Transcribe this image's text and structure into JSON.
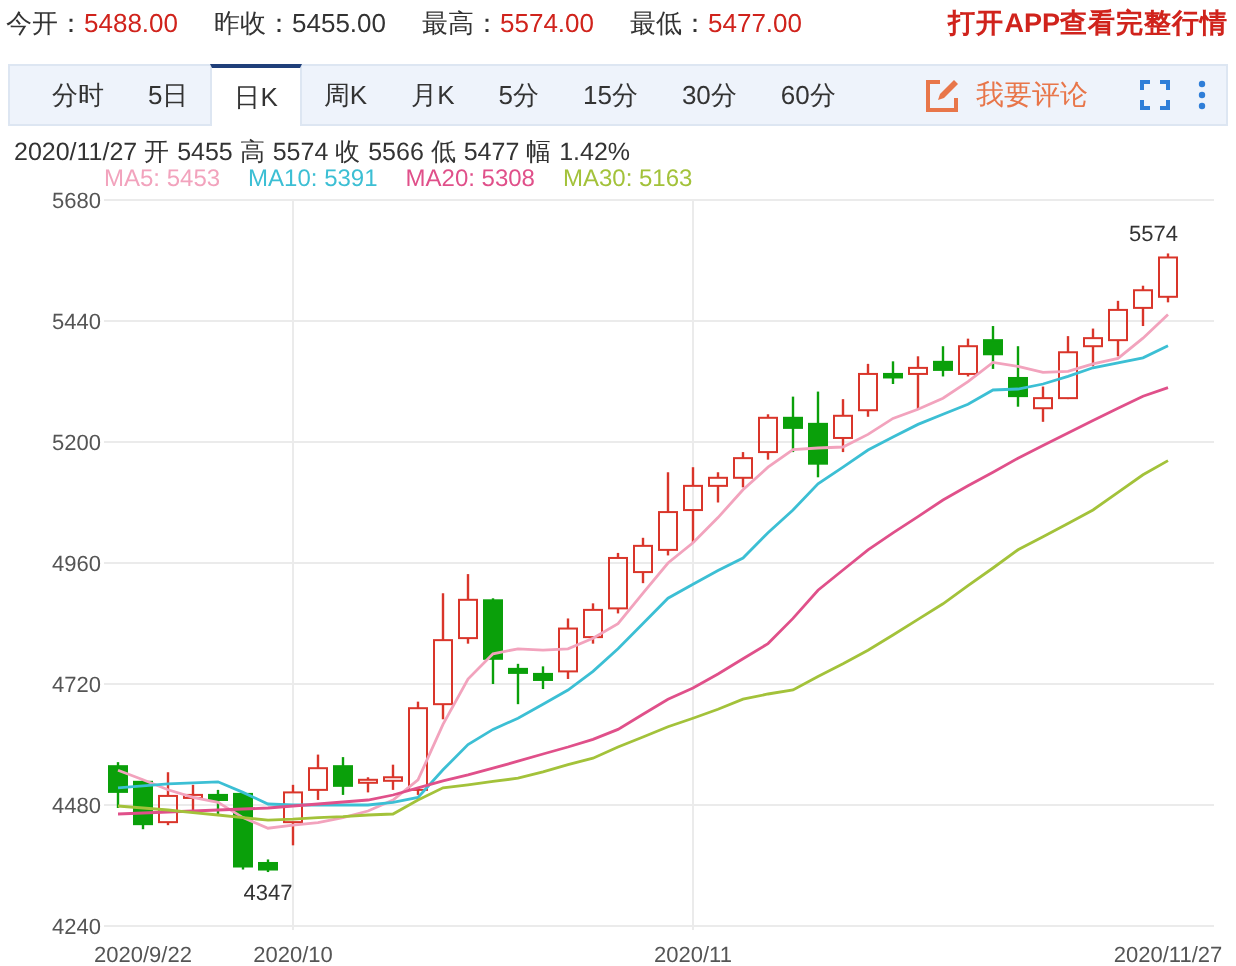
{
  "quote_stats": [
    {
      "label": "今开：",
      "value": "5488.00",
      "kind": "up"
    },
    {
      "label": "昨收：",
      "value": "5455.00",
      "kind": "flat"
    },
    {
      "label": "最高：",
      "value": "5574.00",
      "kind": "up"
    },
    {
      "label": "最低：",
      "value": "5477.00",
      "kind": "up"
    }
  ],
  "app_link": "打开APP查看完整行情",
  "tabs": [
    {
      "label": "分时",
      "selected": false
    },
    {
      "label": "5日",
      "selected": false
    },
    {
      "label": "日K",
      "selected": true
    },
    {
      "label": "周K",
      "selected": false
    },
    {
      "label": "月K",
      "selected": false
    },
    {
      "label": "5分",
      "selected": false
    },
    {
      "label": "15分",
      "selected": false
    },
    {
      "label": "30分",
      "selected": false
    },
    {
      "label": "60分",
      "selected": false
    }
  ],
  "comment_button": "我要评论",
  "info_line": "2020/11/27 开 5455 高 5574 收 5566 低 5477 幅 1.42%",
  "chart": {
    "chart_data": {
      "type": "candlestick",
      "grid": true,
      "ylim": [
        4240,
        5680
      ],
      "yticks": [
        4240,
        4480,
        4720,
        4960,
        5200,
        5440,
        5680
      ],
      "categories": [
        null,
        "2020/9/22",
        null,
        null,
        null,
        null,
        null,
        "2020/10",
        null,
        null,
        null,
        null,
        null,
        null,
        null,
        null,
        null,
        null,
        null,
        null,
        null,
        null,
        null,
        "2020/11",
        null,
        null,
        null,
        null,
        null,
        null,
        null,
        null,
        null,
        null,
        null,
        null,
        null,
        null,
        null,
        null,
        null,
        null,
        "2020/11/27"
      ],
      "ohlc": [
        [
          4557,
          4565,
          4474,
          4506
        ],
        [
          4526,
          4530,
          4432,
          4442
        ],
        [
          4446,
          4545,
          4440,
          4498
        ],
        [
          4495,
          4520,
          4470,
          4500
        ],
        [
          4500,
          4510,
          4460,
          4490
        ],
        [
          4502,
          4505,
          4352,
          4358
        ],
        [
          4365,
          4372,
          4347,
          4352
        ],
        [
          4446,
          4520,
          4400,
          4505
        ],
        [
          4510,
          4580,
          4490,
          4553
        ],
        [
          4557,
          4575,
          4500,
          4518
        ],
        [
          4525,
          4535,
          4505,
          4530
        ],
        [
          4528,
          4560,
          4510,
          4535
        ],
        [
          4510,
          4685,
          4500,
          4672
        ],
        [
          4680,
          4900,
          4650,
          4807
        ],
        [
          4811,
          4938,
          4800,
          4887
        ],
        [
          4886,
          4890,
          4720,
          4770
        ],
        [
          4750,
          4760,
          4680,
          4742
        ],
        [
          4740,
          4755,
          4710,
          4728
        ],
        [
          4745,
          4850,
          4730,
          4830
        ],
        [
          4813,
          4880,
          4800,
          4867
        ],
        [
          4870,
          4980,
          4860,
          4970
        ],
        [
          4942,
          5010,
          4920,
          4994
        ],
        [
          4986,
          5140,
          4975,
          5061
        ],
        [
          5065,
          5150,
          5000,
          5113
        ],
        [
          5113,
          5140,
          5080,
          5129
        ],
        [
          5129,
          5180,
          5110,
          5168
        ],
        [
          5180,
          5255,
          5165,
          5248
        ],
        [
          5248,
          5290,
          5180,
          5228
        ],
        [
          5236,
          5300,
          5130,
          5157
        ],
        [
          5208,
          5285,
          5180,
          5252
        ],
        [
          5263,
          5355,
          5250,
          5335
        ],
        [
          5335,
          5360,
          5315,
          5328
        ],
        [
          5335,
          5370,
          5265,
          5347
        ],
        [
          5359,
          5390,
          5330,
          5343
        ],
        [
          5335,
          5405,
          5330,
          5390
        ],
        [
          5402,
          5430,
          5345,
          5374
        ],
        [
          5327,
          5390,
          5270,
          5291
        ],
        [
          5267,
          5310,
          5240,
          5287
        ],
        [
          5287,
          5410,
          5285,
          5378
        ],
        [
          5390,
          5425,
          5350,
          5406
        ],
        [
          5402,
          5480,
          5370,
          5462
        ],
        [
          5466,
          5510,
          5430,
          5501
        ],
        [
          5488,
          5574,
          5477,
          5566
        ]
      ],
      "annotations": [
        "5574",
        "4347"
      ]
    }
  },
  "ma_chart": {
    "chart_data": {
      "type": "line",
      "ylim": [
        4240,
        5680
      ],
      "series": [
        {
          "name": "MA5: 5453",
          "color": "#f2a3bd",
          "values": [
            4549,
            4530,
            4510,
            4495,
            4485,
            4455,
            4434,
            4440,
            4445,
            4455,
            4468,
            4490,
            4530,
            4640,
            4730,
            4780,
            4790,
            4787,
            4790,
            4811,
            4840,
            4900,
            4960,
            5000,
            5050,
            5105,
            5150,
            5185,
            5188,
            5190,
            5215,
            5247,
            5265,
            5287,
            5320,
            5358,
            5350,
            5338,
            5340,
            5355,
            5366,
            5406,
            5453
          ]
        },
        {
          "name": "MA10: 5391",
          "color": "#3cbfd4",
          "values": [
            4514,
            4518,
            4522,
            4524,
            4526,
            4505,
            4482,
            4480,
            4480,
            4480,
            4480,
            4485,
            4495,
            4550,
            4600,
            4630,
            4652,
            4680,
            4708,
            4745,
            4790,
            4840,
            4890,
            4918,
            4945,
            4970,
            5020,
            5065,
            5117,
            5150,
            5184,
            5210,
            5235,
            5255,
            5275,
            5303,
            5305,
            5315,
            5330,
            5347,
            5357,
            5367,
            5391
          ]
        },
        {
          "name": "MA20: 5308",
          "color": "#e0508a",
          "values": [
            4462,
            4464,
            4466,
            4468,
            4470,
            4472,
            4474,
            4478,
            4482,
            4486,
            4490,
            4500,
            4514,
            4528,
            4540,
            4553,
            4567,
            4581,
            4595,
            4610,
            4630,
            4660,
            4690,
            4712,
            4740,
            4770,
            4800,
            4850,
            4906,
            4946,
            4986,
            5020,
            5052,
            5085,
            5113,
            5140,
            5168,
            5193,
            5218,
            5243,
            5267,
            5291,
            5308
          ]
        },
        {
          "name": "MA30: 5163",
          "color": "#a3c23a",
          "values": [
            4478,
            4474,
            4470,
            4465,
            4460,
            4455,
            4450,
            4452,
            4455,
            4457,
            4460,
            4462,
            4490,
            4514,
            4520,
            4527,
            4533,
            4546,
            4560,
            4573,
            4595,
            4615,
            4635,
            4652,
            4670,
            4690,
            4700,
            4708,
            4735,
            4760,
            4787,
            4817,
            4848,
            4879,
            4915,
            4950,
            4986,
            5012,
            5038,
            5065,
            5100,
            5135,
            5163
          ]
        }
      ]
    }
  }
}
